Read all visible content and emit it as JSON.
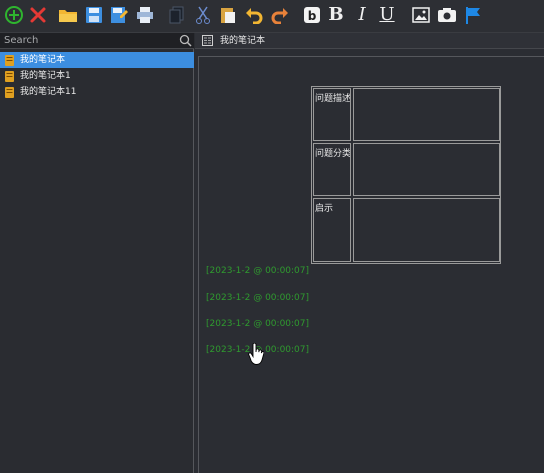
{
  "toolbar": {
    "buttons": [
      {
        "name": "add-icon",
        "color": "#2fb52f"
      },
      {
        "name": "delete-icon",
        "color": "#e53935"
      },
      {
        "name": "open-folder-icon",
        "color": "#f2b632"
      },
      {
        "name": "save-icon",
        "color": "#3d8fe0"
      },
      {
        "name": "save-as-icon",
        "color": "#3d8fe0"
      },
      {
        "name": "print-icon",
        "color": "#9fb7d8"
      },
      {
        "name": "copy-icon",
        "color": "#2f3a4a"
      },
      {
        "name": "cut-icon",
        "color": "#6c8ccf"
      },
      {
        "name": "paste-icon",
        "color": "#d9a441"
      },
      {
        "name": "undo-icon",
        "color": "#f2b632"
      },
      {
        "name": "redo-icon",
        "color": "#e8823a"
      },
      {
        "name": "code-block-icon",
        "color": "#ffffff"
      },
      {
        "name": "bold-icon",
        "label": "B"
      },
      {
        "name": "italic-icon",
        "label": "I"
      },
      {
        "name": "underline-icon",
        "label": "U"
      },
      {
        "name": "insert-image-icon",
        "color": "#ffffff"
      },
      {
        "name": "screenshot-icon",
        "color": "#ffffff"
      },
      {
        "name": "flag-icon",
        "color": "#1e88e5"
      }
    ]
  },
  "search": {
    "placeholder": "Search"
  },
  "notebooks": [
    {
      "label": "我的笔记本",
      "selected": true
    },
    {
      "label": "我的笔记本1",
      "selected": false
    },
    {
      "label": "我的笔记本11",
      "selected": false
    }
  ],
  "tab": {
    "title": "我的笔记本"
  },
  "note_table": {
    "rows": [
      {
        "label": "问题描述",
        "value": ""
      },
      {
        "label": "问题分类",
        "value": ""
      },
      {
        "label": "启示",
        "value": ""
      }
    ]
  },
  "timestamps": [
    "[2023-1-2 @ 00:00:07]",
    "[2023-1-2 @ 00:00:07]",
    "[2023-1-2 @ 00:00:07]",
    "[2023-1-2 @ 00:00:07]"
  ],
  "colors": {
    "selection": "#3c8ee0",
    "timestamp": "#2f9a2f",
    "background": "#2a2c31"
  }
}
